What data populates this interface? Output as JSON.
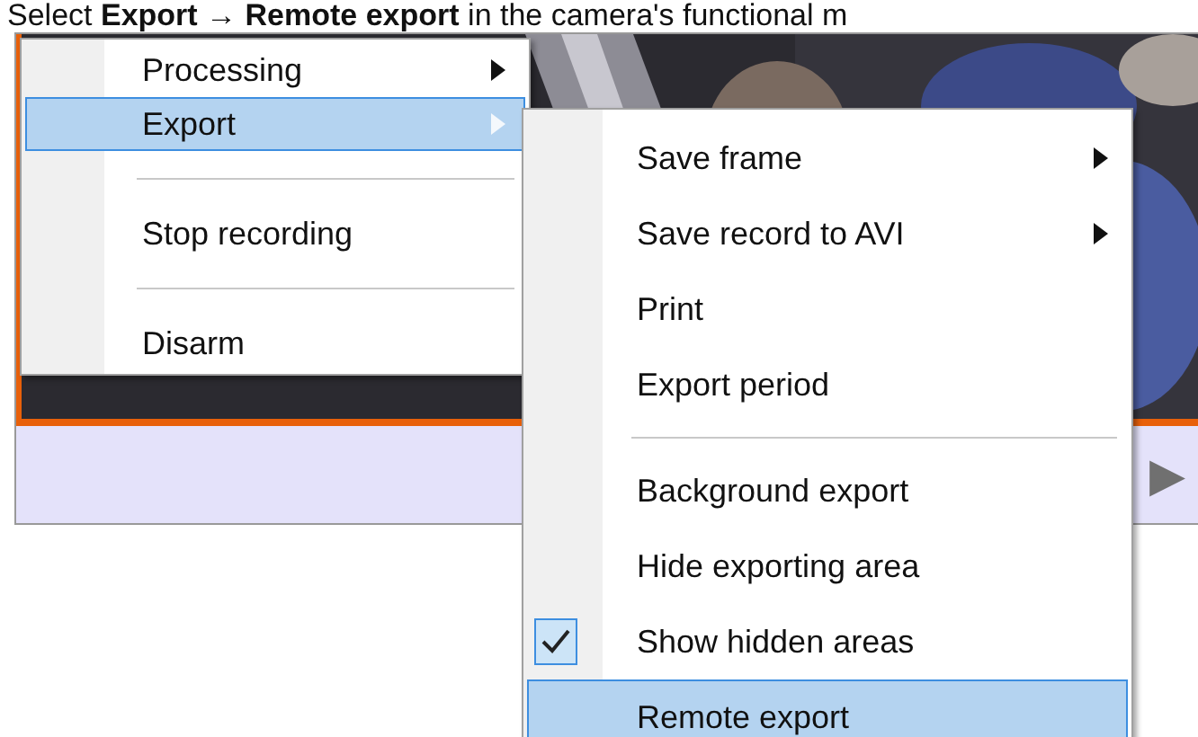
{
  "caption": "Select **Export** → **Remote export** in the camera's functional m",
  "camera": {
    "controls": {
      "play": "▶"
    }
  },
  "context_menu": {
    "items": [
      {
        "kind": "item",
        "label": "Processing",
        "has_submenu": true,
        "selected": false
      },
      {
        "kind": "item",
        "label": "Export",
        "has_submenu": true,
        "selected": true
      },
      {
        "kind": "separator"
      },
      {
        "kind": "item",
        "label": "Stop recording",
        "has_submenu": false,
        "selected": false
      },
      {
        "kind": "separator"
      },
      {
        "kind": "item",
        "label": "Disarm",
        "has_submenu": false,
        "selected": false
      }
    ]
  },
  "export_submenu": {
    "items": [
      {
        "kind": "item",
        "label": "Save frame",
        "has_submenu": true,
        "checked": false,
        "selected": false
      },
      {
        "kind": "item",
        "label": "Save record to AVI",
        "has_submenu": true,
        "checked": false,
        "selected": false
      },
      {
        "kind": "item",
        "label": "Print",
        "has_submenu": false,
        "checked": false,
        "selected": false
      },
      {
        "kind": "item",
        "label": "Export period",
        "has_submenu": false,
        "checked": false,
        "selected": false
      },
      {
        "kind": "separator"
      },
      {
        "kind": "item",
        "label": "Background export",
        "has_submenu": false,
        "checked": false,
        "selected": false
      },
      {
        "kind": "item",
        "label": "Hide exporting area",
        "has_submenu": false,
        "checked": false,
        "selected": false
      },
      {
        "kind": "item",
        "label": "Show hidden areas",
        "has_submenu": false,
        "checked": true,
        "selected": false
      },
      {
        "kind": "item",
        "label": "Remote export",
        "has_submenu": false,
        "checked": false,
        "selected": true
      }
    ]
  }
}
